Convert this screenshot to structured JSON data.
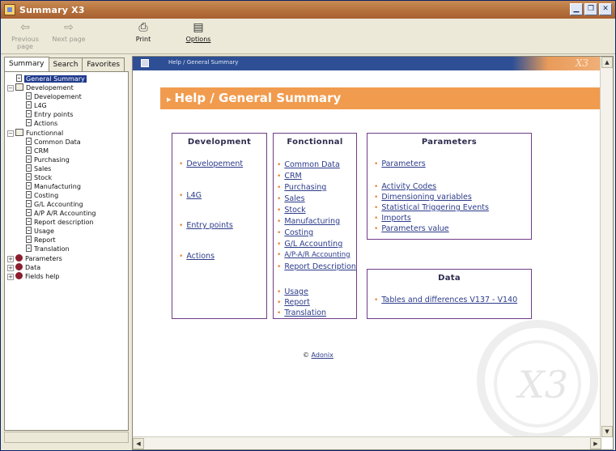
{
  "window": {
    "title": "Summary X3"
  },
  "toolbar": {
    "previous_label": "Previous page",
    "next_label": "Next page",
    "print_label": "Print",
    "options_label": "Options"
  },
  "left_panel": {
    "tabs": [
      "Summary",
      "Search",
      "Favorites"
    ],
    "tree": {
      "root": "General Summary",
      "developement": {
        "label": "Developement",
        "children": [
          "Developement",
          "L4G",
          "Entry points",
          "Actions"
        ]
      },
      "functionnal": {
        "label": "Functionnal",
        "children": [
          "Common Data",
          "CRM",
          "Purchasing",
          "Sales",
          "Stock",
          "Manufacturing",
          "Costing",
          "G/L Accounting",
          "A/P A/R Accounting",
          "Report description",
          "Usage",
          "Report",
          "Translation"
        ]
      },
      "others": [
        "Parameters",
        "Data",
        "Fields help"
      ]
    }
  },
  "content": {
    "breadcrumb": "Help / General Summary",
    "heading": "Help / General Summary",
    "development": {
      "title": "Development",
      "links": [
        "Developement",
        "L4G",
        "Entry points",
        "Actions"
      ]
    },
    "functional": {
      "title": "Fonctionnal",
      "links": [
        "Common Data",
        "CRM",
        "Purchasing",
        "Sales",
        "Stock",
        "Manufacturing",
        "Costing",
        "G/L Accounting",
        "A/P-A/R Accounting",
        "Report Description",
        "Usage",
        "Report",
        "Translation"
      ]
    },
    "parameters": {
      "title": "Parameters",
      "links": [
        "Parameters",
        "Activity Codes",
        "Dimensioning variables",
        "Statistical Triggering Events",
        "Imports",
        "Parameters value"
      ]
    },
    "data": {
      "title": "Data",
      "links": [
        "Tables and differences V137 - V140"
      ]
    },
    "footer_prefix": "©",
    "footer_link": "Adonix",
    "watermark": "X3"
  }
}
